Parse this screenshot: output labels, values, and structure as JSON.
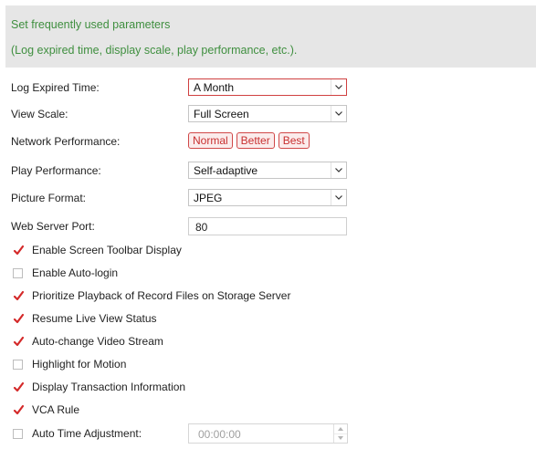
{
  "banner": {
    "line1": "Set frequently used parameters",
    "line2": "(Log expired time, display scale, play performance, etc.)."
  },
  "settings": {
    "log_expired_time": {
      "label": "Log Expired Time:",
      "value": "A Month",
      "icon": "chevron-down-icon"
    },
    "view_scale": {
      "label": "View Scale:",
      "value": "Full Screen",
      "icon": "chevron-down-icon"
    },
    "network_performance": {
      "label": "Network Performance:",
      "options": [
        "Normal",
        "Better",
        "Best"
      ]
    },
    "play_performance": {
      "label": "Play Performance:",
      "value": "Self-adaptive",
      "icon": "chevron-down-icon"
    },
    "picture_format": {
      "label": "Picture Format:",
      "value": "JPEG",
      "icon": "chevron-down-icon"
    },
    "web_server_port": {
      "label": "Web Server Port:",
      "value": "80"
    }
  },
  "checkboxes": [
    {
      "label": "Enable Screen Toolbar Display",
      "checked": true
    },
    {
      "label": "Enable Auto-login",
      "checked": false
    },
    {
      "label": "Prioritize Playback of Record Files on Storage Server",
      "checked": true
    },
    {
      "label": "Resume Live View Status",
      "checked": true
    },
    {
      "label": "Auto-change Video Stream",
      "checked": true
    },
    {
      "label": "Highlight for Motion",
      "checked": false
    },
    {
      "label": "Display Transaction Information",
      "checked": true
    },
    {
      "label": "VCA Rule",
      "checked": true
    }
  ],
  "auto_time": {
    "label": "Auto Time Adjustment:",
    "checked": false,
    "value": "00:00:00"
  },
  "colors": {
    "banner_text": "#3f8f3f",
    "banner_bg": "#e6e6e6",
    "accent_red": "#d04040",
    "check_red": "#d42a2a"
  }
}
